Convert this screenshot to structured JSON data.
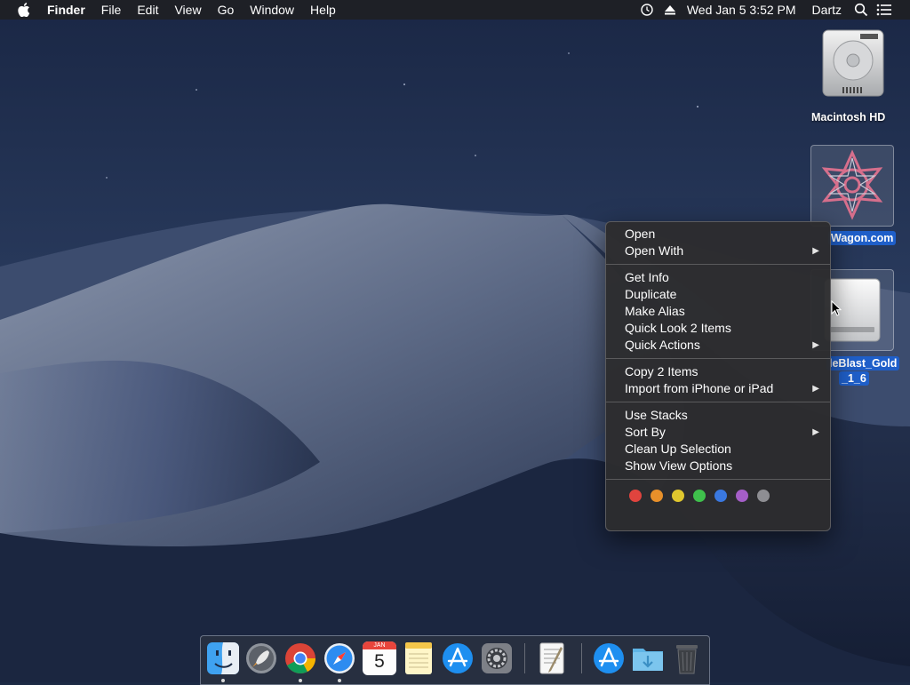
{
  "menubar": {
    "app_name": "Finder",
    "menus": [
      "File",
      "Edit",
      "View",
      "Go",
      "Window",
      "Help"
    ],
    "clock": "Wed Jan 5  3:52 PM",
    "user": "Dartz"
  },
  "desktop_icons": {
    "macintosh_hd": "Macintosh HD",
    "wagon": "Wagon.com",
    "blast_line1": "leBlast_Gold",
    "blast_line2": "_1_6"
  },
  "context_menu": {
    "open": "Open",
    "open_with": "Open With",
    "get_info": "Get Info",
    "duplicate": "Duplicate",
    "make_alias": "Make Alias",
    "quick_look": "Quick Look 2 Items",
    "quick_actions": "Quick Actions",
    "copy": "Copy 2 Items",
    "import": "Import from iPhone or iPad",
    "use_stacks": "Use Stacks",
    "sort_by": "Sort By",
    "clean_up": "Clean Up Selection",
    "show_view_options": "Show View Options",
    "tag_colors": [
      "#e0443e",
      "#e8902a",
      "#e0c72e",
      "#3fc04c",
      "#3a78e0",
      "#a55ec8",
      "#8e8e93"
    ]
  },
  "dock": {
    "calendar_month": "JAN",
    "calendar_day": "5"
  },
  "colors": {
    "selection_blue": "#1f5fc9"
  }
}
